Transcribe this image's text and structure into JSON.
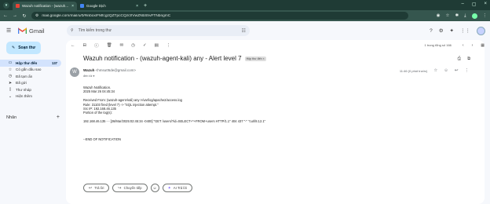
{
  "browser": {
    "tabs": [
      {
        "title": "Wazuh notification - (wazuh-agent-kali) any - Alert level 7",
        "active": true,
        "favicon_color": "#ea4335"
      },
      {
        "title": "Google Dịch",
        "active": false,
        "favicon_color": "#4285f4"
      }
    ],
    "url": "mail.google.com/mail/u/0/#inbox/FMfcgzQZTpcCQzrzfVwZNbShvFTNbngmC"
  },
  "gmail": {
    "brand": "Gmail",
    "search_placeholder": "Tìm kiếm trong thư"
  },
  "sidebar": {
    "compose_label": "Soạn thư",
    "items": [
      {
        "label": "Hộp thư đến",
        "count": "137",
        "icon": "inbox-icon",
        "active": true
      },
      {
        "label": "Có gắn dấu sao",
        "count": "",
        "icon": "star-icon",
        "active": false
      },
      {
        "label": "Đã tạm ẩn",
        "count": "",
        "icon": "clock-icon",
        "active": false
      },
      {
        "label": "Đã gửi",
        "count": "",
        "icon": "send-icon",
        "active": false
      },
      {
        "label": "Thư nháp",
        "count": "",
        "icon": "draft-icon",
        "active": false
      },
      {
        "label": "Hiện thêm",
        "count": "",
        "icon": "chevron-down-icon",
        "active": false
      }
    ],
    "labels_heading": "Nhãn"
  },
  "message_toolbar": {
    "pager": "1 trong tổng số 166"
  },
  "email": {
    "subject": "Wazuh notification - (wazuh-agent-kali) any - Alert level 7",
    "badge": "Hộp thư đến ×",
    "sender_name": "Wazuh",
    "sender_email": "<hmsu05de@gmail.com>",
    "to": "đến tôi ▾",
    "time": "11:46 (0 phút trước)",
    "avatar_letter": "W",
    "body_lines": [
      "Wazuh Notification.",
      "2025 Mar 26 04:45:34",
      "",
      "Received From: (wazuh-agent-kali) any->/var/log/apache2/access.log",
      "Rule: 31103 fired (level 7) -> \"SQL injection attempt.\"",
      "Src IP: 192.168.46.135",
      "Portion of the log(s):",
      "",
      "192.168.46.135 - - [26/Mar/2025:02:45:34 -0400] \"GET /users/?id=SELECT+*+FROM+users HTTP/1.1\" 404 437 \"-\" \"curl/8.12.1\"",
      "",
      "",
      "--END OF NOTIFICATION"
    ]
  },
  "actions": {
    "reply": "Trả lời",
    "forward": "Chuyển tiếp",
    "ai_reply": "AI Trả lời"
  }
}
